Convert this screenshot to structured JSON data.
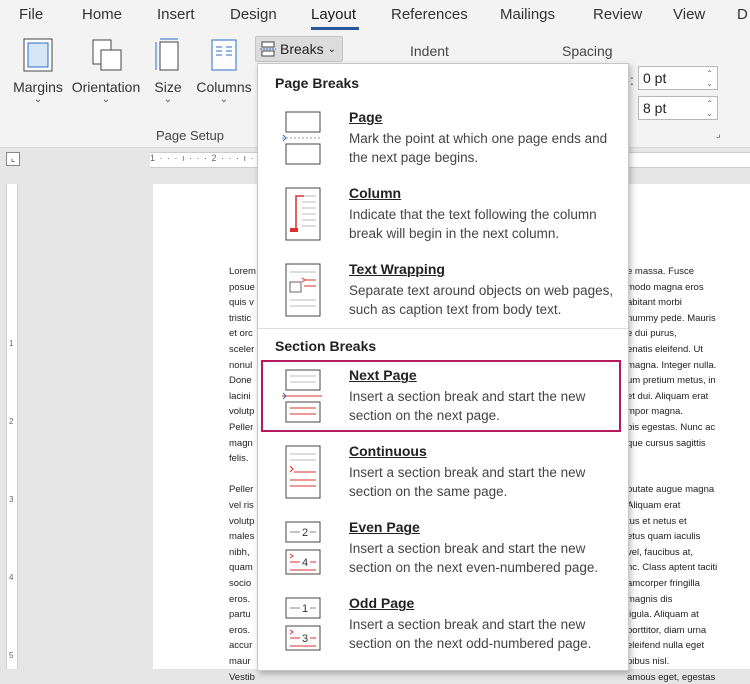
{
  "tabs": [
    {
      "label": "File",
      "active": false
    },
    {
      "label": "Home",
      "active": false
    },
    {
      "label": "Insert",
      "active": false
    },
    {
      "label": "Design",
      "active": false
    },
    {
      "label": "Layout",
      "active": true
    },
    {
      "label": "References",
      "active": false
    },
    {
      "label": "Mailings",
      "active": false
    },
    {
      "label": "Review",
      "active": false
    },
    {
      "label": "View",
      "active": false
    },
    {
      "label": "D",
      "active": false
    }
  ],
  "ribbon": {
    "margins": "Margins",
    "orientation": "Orientation",
    "size": "Size",
    "columns": "Columns",
    "breaks": "Breaks",
    "page_setup": "Page Setup",
    "indent": "Indent",
    "spacing": "Spacing",
    "spacing_before": "0 pt",
    "spacing_after": "8 pt"
  },
  "menu": {
    "page_breaks_header": "Page Breaks",
    "section_breaks_header": "Section Breaks",
    "items": [
      {
        "title": "Page",
        "desc": "Mark the point at which one page ends and the next page begins."
      },
      {
        "title": "Column",
        "desc": "Indicate that the text following the column break will begin in the next column."
      },
      {
        "title": "Text Wrapping",
        "desc": "Separate text around objects on web pages, such as caption text from body text."
      },
      {
        "title": "Next Page",
        "desc": "Insert a section break and start the new section on the next page."
      },
      {
        "title": "Continuous",
        "desc": "Insert a section break and start the new section on the same page."
      },
      {
        "title": "Even Page",
        "desc": "Insert a section break and start the new section on the next even-numbered page."
      },
      {
        "title": "Odd Page",
        "desc": "Insert a section break and start the new section on the next odd-numbered page."
      }
    ],
    "icon_numbers": {
      "even_top": "2",
      "even_bottom": "4",
      "odd_top": "1",
      "odd_bottom": "3"
    }
  },
  "ruler_text": "1 · · · ı · · · 2 · · · ı · · · 3 · · · ı · · · 4 · · · ı · · · 5 · · · ı · · · 6 · · · ı ·",
  "vruler_ticks": [
    "1",
    "2",
    "3",
    "4",
    "5"
  ],
  "document": {
    "left_lines": [
      "Lorem",
      "posue",
      "quis v",
      "tristic",
      "et orc",
      "sceler",
      "nonul",
      "Done",
      "lacini",
      "volutp",
      "Peller",
      "magn",
      "felis.",
      "",
      "Peller",
      "vel ris",
      "volutp",
      "males",
      "nibh,",
      "quam",
      "socio",
      "eros.",
      "partu",
      "eros.",
      "accur",
      "maur",
      "Vestib"
    ],
    "right_lines": [
      "e massa. Fusce",
      "modo magna eros",
      "abitant morbi",
      "nummy pede. Mauris",
      "e dui purus,",
      "enatis eleifend. Ut",
      "magna. Integer nulla.",
      "um pretium metus, in",
      "et dui. Aliquam erat",
      "mpor magna.",
      "bis egestas. Nunc ac",
      "que cursus sagittis",
      "",
      "",
      "putate augue magna",
      "Aliquam erat",
      "tus et netus et",
      "etus quam iaculis",
      "vel, faucibus at,",
      "nc. Class aptent taciti",
      "amcorper fringilla",
      "magnis dis",
      "ligula. Aliquam at",
      "porttitor, diam urna",
      "eleifend nulla eget",
      "pibus nisl.",
      "amous eget, egestas"
    ]
  }
}
